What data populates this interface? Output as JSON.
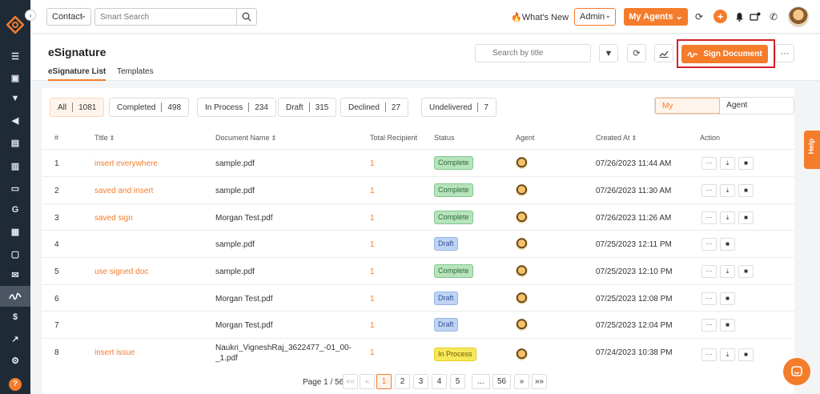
{
  "topbar": {
    "contact_label": "Contact",
    "search_placeholder": "Smart Search",
    "whats_new": "What's New",
    "admin_label": "Admin",
    "my_agents": "My Agents"
  },
  "header": {
    "title": "eSignature",
    "tabs": [
      "eSignature List",
      "Templates"
    ],
    "search_placeholder": "Search by title",
    "sign_document": "Sign Document"
  },
  "filters": [
    {
      "label": "All",
      "count": "1081"
    },
    {
      "label": "Completed",
      "count": "498"
    },
    {
      "label": "In Process",
      "count": "234"
    },
    {
      "label": "Draft",
      "count": "315"
    },
    {
      "label": "Declined",
      "count": "27"
    },
    {
      "label": "Undelivered",
      "count": "7"
    }
  ],
  "signature_toggle": [
    "My Signatures",
    "Agent Signatures"
  ],
  "table": {
    "headers": [
      "#",
      "Title",
      "Document Name",
      "Total Recipient",
      "Status",
      "Agent",
      "Created At",
      "Action"
    ],
    "rows": [
      {
        "n": "1",
        "title": "insert everywhere",
        "doc": "sample.pdf",
        "doc2": "",
        "recipients": "1",
        "status": "Complete",
        "created": "07/26/2023 11:44 AM"
      },
      {
        "n": "2",
        "title": "saved and insert",
        "doc": "sample.pdf",
        "doc2": "",
        "recipients": "1",
        "status": "Complete",
        "created": "07/26/2023 11:30 AM"
      },
      {
        "n": "3",
        "title": "saved sign",
        "doc": "Morgan Test.pdf",
        "doc2": "",
        "recipients": "1",
        "status": "Complete",
        "created": "07/26/2023 11:26 AM"
      },
      {
        "n": "4",
        "title": "",
        "doc": "sample.pdf",
        "doc2": "",
        "recipients": "1",
        "status": "Draft",
        "created": "07/25/2023 12:11 PM"
      },
      {
        "n": "5",
        "title": "use signed doc",
        "doc": "sample.pdf",
        "doc2": "",
        "recipients": "1",
        "status": "Complete",
        "created": "07/25/2023 12:10 PM"
      },
      {
        "n": "6",
        "title": "",
        "doc": "Morgan Test.pdf",
        "doc2": "",
        "recipients": "1",
        "status": "Draft",
        "created": "07/25/2023 12:08 PM"
      },
      {
        "n": "7",
        "title": "",
        "doc": "Morgan Test.pdf",
        "doc2": "",
        "recipients": "1",
        "status": "Draft",
        "created": "07/25/2023 12:04 PM"
      },
      {
        "n": "8",
        "title": "insert issue",
        "doc": "Naukri_VigneshRaj_3622477_-01_00-",
        "doc2": "_1.pdf",
        "recipients": "1",
        "status": "In Process",
        "created": "07/24/2023 10:38 PM"
      }
    ]
  },
  "pagination": {
    "text": "Page 1 / 56",
    "buttons": [
      "««",
      "«",
      "1",
      "2",
      "3",
      "4",
      "5",
      "...",
      "56",
      "»",
      "»»"
    ]
  },
  "help_label": "Help",
  "brand_color": "#f57c2b"
}
